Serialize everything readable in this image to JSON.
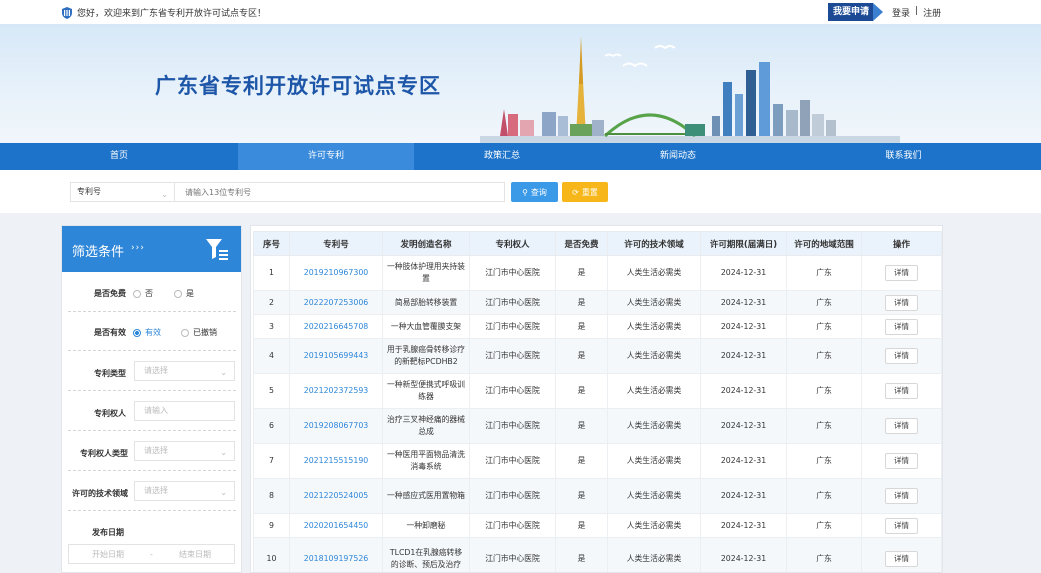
{
  "topbar": {
    "welcome": "您好，欢迎来到广东省专利开放许可试点专区！",
    "apply_label": "我要申请",
    "login_label": "登录",
    "separator": "|",
    "register_label": "注册"
  },
  "banner": {
    "title": "广东省专利开放许可试点专区"
  },
  "nav": {
    "items": [
      {
        "label": "首页"
      },
      {
        "label": "许可专利"
      },
      {
        "label": "政策汇总"
      },
      {
        "label": "新闻动态"
      },
      {
        "label": "联系我们"
      }
    ],
    "active_index": 1
  },
  "search": {
    "type_value": "专利号",
    "placeholder": "请输入13位专利号",
    "query_label": "查询",
    "reset_label": "重置"
  },
  "filter": {
    "title": "筛选条件",
    "arrows": "›››",
    "free_label": "是否免费",
    "free_options": [
      "否",
      "是"
    ],
    "valid_label": "是否有效",
    "valid_options": [
      "有效",
      "已撤销"
    ],
    "type_label": "专利类型",
    "type_placeholder": "请选择",
    "owner_label": "专利权人",
    "owner_placeholder": "请输入",
    "owner_type_label": "专利权人类型",
    "owner_type_placeholder": "请选择",
    "field_label": "许可的技术领域",
    "field_placeholder": "请选择",
    "date_label": "发布日期",
    "date_start": "开始日期",
    "date_sep": "-",
    "date_end": "结束日期"
  },
  "table": {
    "headers": [
      "序号",
      "专利号",
      "发明创造名称",
      "专利权人",
      "是否免费",
      "许可的技术领域",
      "许可期限(届满日)",
      "许可的地域范围",
      "操作"
    ],
    "detail_label": "详情",
    "rows": [
      {
        "no": "1",
        "pn": "2019210967300",
        "name": "一种肢体护理用夹持装置",
        "owner": "江门市中心医院",
        "free": "是",
        "field": "人类生活必需类",
        "term": "2024-12-31",
        "region": "广东"
      },
      {
        "no": "2",
        "pn": "2022207253006",
        "name": "简易部胎转移装置",
        "owner": "江门市中心医院",
        "free": "是",
        "field": "人类生活必需类",
        "term": "2024-12-31",
        "region": "广东"
      },
      {
        "no": "3",
        "pn": "2020216645708",
        "name": "一种大血管覆膜支架",
        "owner": "江门市中心医院",
        "free": "是",
        "field": "人类生活必需类",
        "term": "2024-12-31",
        "region": "广东"
      },
      {
        "no": "4",
        "pn": "2019105699443",
        "name": "用于乳腺癌骨转移诊疗的新靶标PCDHB2",
        "owner": "江门市中心医院",
        "free": "是",
        "field": "人类生活必需类",
        "term": "2024-12-31",
        "region": "广东"
      },
      {
        "no": "5",
        "pn": "2021202372593",
        "name": "一种新型便携式呼吸训练器",
        "owner": "江门市中心医院",
        "free": "是",
        "field": "人类生活必需类",
        "term": "2024-12-31",
        "region": "广东"
      },
      {
        "no": "6",
        "pn": "2019208067703",
        "name": "治疗三叉神经痛的器械总成",
        "owner": "江门市中心医院",
        "free": "是",
        "field": "人类生活必需类",
        "term": "2024-12-31",
        "region": "广东"
      },
      {
        "no": "7",
        "pn": "2021215515190",
        "name": "一种医用平面物品清洗消毒系统",
        "owner": "江门市中心医院",
        "free": "是",
        "field": "人类生活必需类",
        "term": "2024-12-31",
        "region": "广东"
      },
      {
        "no": "8",
        "pn": "2021220524005",
        "name": "一种感应式医用置物箱",
        "owner": "江门市中心医院",
        "free": "是",
        "field": "人类生活必需类",
        "term": "2024-12-31",
        "region": "广东"
      },
      {
        "no": "9",
        "pn": "2020201654450",
        "name": "一种卸磨秘",
        "owner": "江门市中心医院",
        "free": "是",
        "field": "人类生活必需类",
        "term": "2024-12-31",
        "region": "广东"
      },
      {
        "no": "10",
        "pn": "2018109197526",
        "name": "TLCD1在乳腺癌转移的诊断、预后及治疗",
        "owner": "江门市中心医院",
        "free": "是",
        "field": "人类生活必需类",
        "term": "2024-12-31",
        "region": "广东"
      }
    ]
  }
}
